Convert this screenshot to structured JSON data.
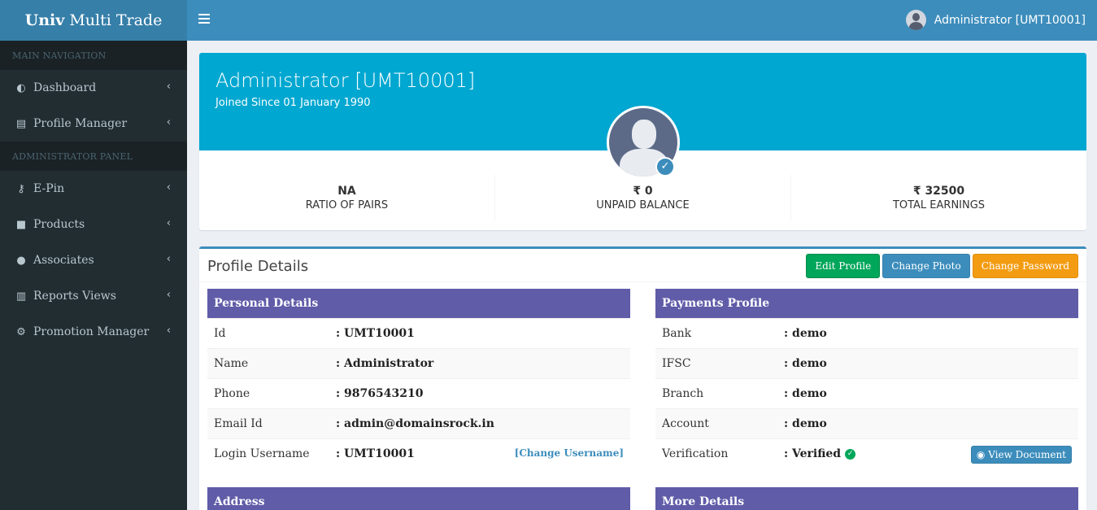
{
  "app": {
    "brand_bold": "Univ",
    "brand_rest": "Multi Trade"
  },
  "header": {
    "user_label": "Administrator [UMT10001]"
  },
  "sidebar": {
    "main_nav_header": "MAIN NAVIGATION",
    "admin_header": "ADMINISTRATOR PANEL",
    "main_items": [
      {
        "label": "Dashboard",
        "icon": "dashboard-icon"
      },
      {
        "label": "Profile Manager",
        "icon": "id-card-icon"
      }
    ],
    "admin_items": [
      {
        "label": "E-Pin",
        "icon": "key-icon"
      },
      {
        "label": "Products",
        "icon": "shopping-bag-icon"
      },
      {
        "label": "Associates",
        "icon": "user-icon"
      },
      {
        "label": "Reports Views",
        "icon": "bar-chart-icon"
      },
      {
        "label": "Promotion Manager",
        "icon": "gears-icon"
      }
    ]
  },
  "profile": {
    "name": "Administrator [UMT10001]",
    "joined": "Joined Since 01 January 1990",
    "stats": [
      {
        "value": "NA",
        "label": "RATIO OF PAIRS"
      },
      {
        "value": "₹ 0",
        "label": "UNPAID BALANCE"
      },
      {
        "value": "₹ 32500",
        "label": "TOTAL EARNINGS"
      }
    ]
  },
  "details": {
    "title": "Profile Details",
    "buttons": {
      "edit": "Edit Profile",
      "photo": "Change Photo",
      "password": "Change Password"
    },
    "personal": {
      "header": "Personal Details",
      "rows": [
        {
          "k": "Id",
          "v": ": UMT10001"
        },
        {
          "k": "Name",
          "v": ": Administrator"
        },
        {
          "k": "Phone",
          "v": ": 9876543210"
        },
        {
          "k": "Email Id",
          "v": ": admin@domainsrock.in"
        },
        {
          "k": "Login Username",
          "v": ": UMT10001"
        }
      ],
      "change_username": "[Change Username]"
    },
    "payments": {
      "header": "Payments Profile",
      "rows": [
        {
          "k": "Bank",
          "v": ": demo"
        },
        {
          "k": "IFSC",
          "v": ": demo"
        },
        {
          "k": "Branch",
          "v": ": demo"
        },
        {
          "k": "Account",
          "v": ": demo"
        },
        {
          "k": "Verification",
          "v": ": Verified"
        }
      ],
      "view_document": "View Document"
    },
    "address_header": "Address",
    "more_header": "More Details"
  },
  "colors": {
    "accent": "#3c8dbc",
    "banner": "#00a7d0",
    "panel_head": "#605ca8",
    "sidebar": "#222d32"
  }
}
